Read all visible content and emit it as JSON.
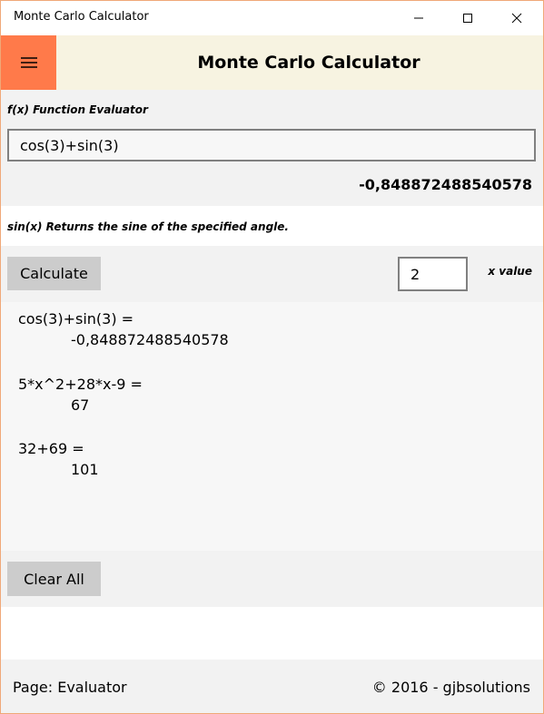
{
  "window": {
    "title": "Monte Carlo Calculator",
    "controls": {
      "minimize": "minimize-icon",
      "maximize": "maximize-icon",
      "close": "close-icon"
    }
  },
  "header": {
    "menu_icon": "hamburger-icon",
    "title": "Monte Carlo Calculator",
    "menu_color": "#ff7a4a",
    "background": "#f7f3e1"
  },
  "evaluator": {
    "label": "f(x) Function Evaluator",
    "expression": "cos(3)+sin(3)",
    "result": "-0,848872488540578"
  },
  "description": {
    "text": "sin(x) Returns the sine of the specified angle."
  },
  "calc": {
    "button_label": "Calculate",
    "x_value": "2",
    "x_label": "x value"
  },
  "results": [
    {
      "expr": "cos(3)+sin(3) =",
      "value": "-0,848872488540578"
    },
    {
      "expr": "5*x^2+28*x-9 =",
      "value": "67"
    },
    {
      "expr": "32+69 =",
      "value": "101"
    }
  ],
  "clear": {
    "button_label": "Clear All"
  },
  "footer": {
    "page": "Page: Evaluator",
    "copyright": "© 2016 - gjbsolutions"
  }
}
